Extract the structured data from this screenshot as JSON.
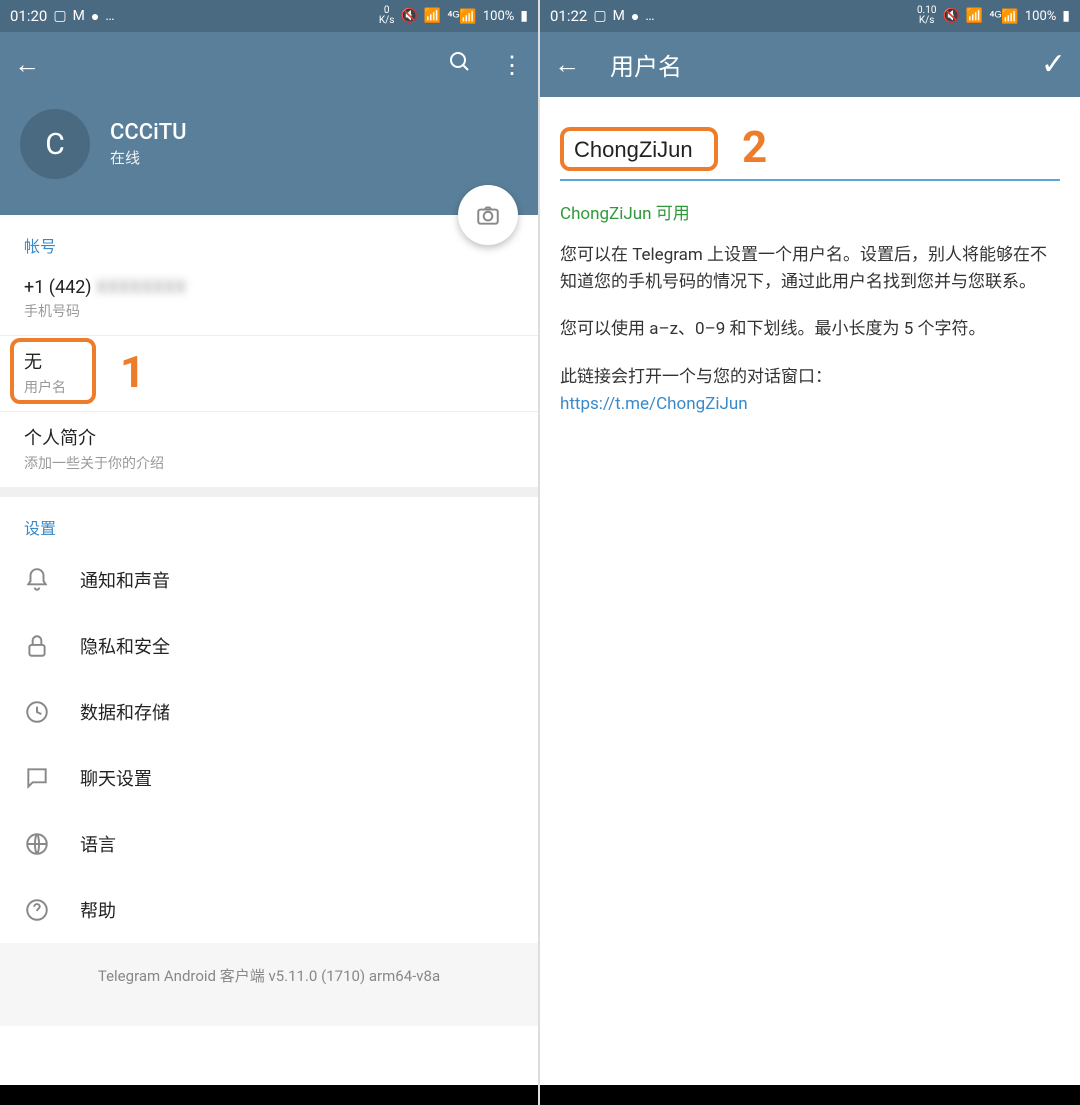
{
  "left": {
    "status": {
      "time": "01:20",
      "net": "0\nK/s",
      "battery": "100%"
    },
    "profile": {
      "avatar_letter": "C",
      "name": "CCCiTU",
      "status": "在线"
    },
    "account": {
      "section": "帐号",
      "phone_value": "+1 (442)",
      "phone_label": "手机号码",
      "username_value": "无",
      "username_label": "用户名",
      "bio_value": "个人简介",
      "bio_label": "添加一些关于你的介绍"
    },
    "settings": {
      "section": "设置",
      "items": [
        {
          "label": "通知和声音"
        },
        {
          "label": "隐私和安全"
        },
        {
          "label": "数据和存储"
        },
        {
          "label": "聊天设置"
        },
        {
          "label": "语言"
        },
        {
          "label": "帮助"
        }
      ]
    },
    "footer": "Telegram Android 客户端 v5.11.0 (1710) arm64-v8a",
    "annotation": "1"
  },
  "right": {
    "status": {
      "time": "01:22",
      "net": "0.10\nK/s",
      "battery": "100%"
    },
    "nav_title": "用户名",
    "username_value": "ChongZiJun",
    "available": "ChongZiJun 可用",
    "para1": "您可以在 Telegram 上设置一个用户名。设置后，别人将能够在不知道您的手机号码的情况下，通过此用户名找到您并与您联系。",
    "para2": "您可以使用 a–z、0–9 和下划线。最小长度为 5 个字符。",
    "para3": "此链接会打开一个与您的对话窗口：",
    "link": "https://t.me/ChongZiJun",
    "annotation": "2"
  }
}
